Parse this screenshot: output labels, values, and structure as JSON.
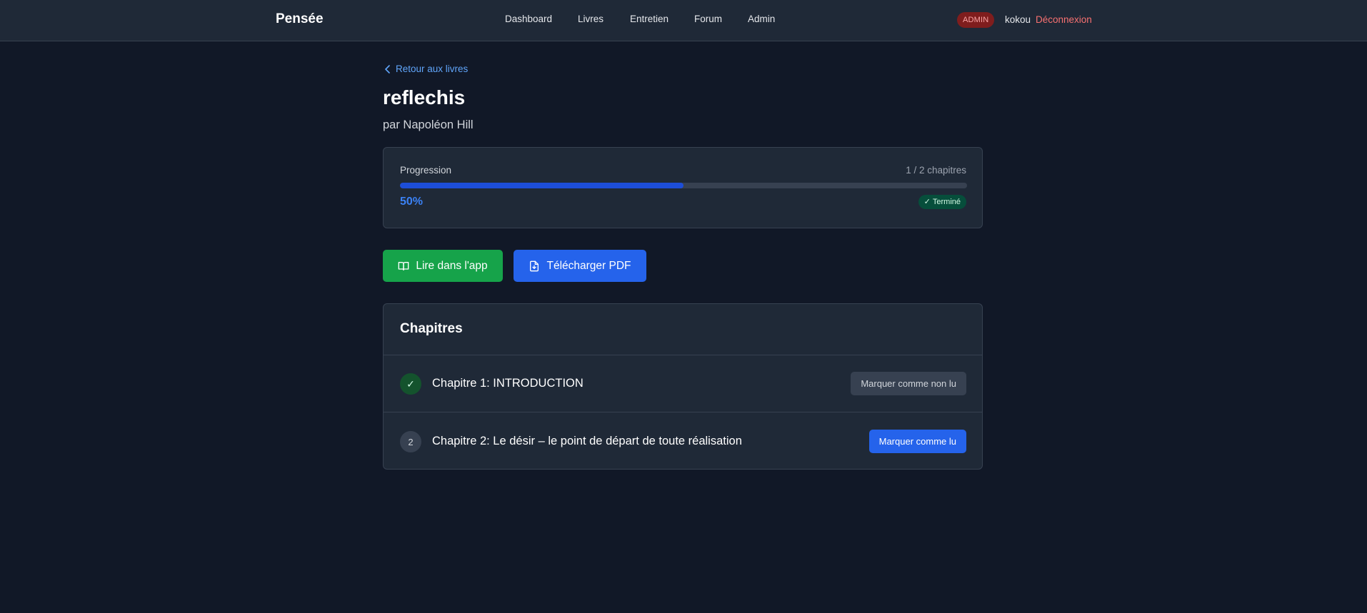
{
  "header": {
    "brand": "Pensée",
    "nav": [
      {
        "label": "Dashboard"
      },
      {
        "label": "Livres"
      },
      {
        "label": "Entretien"
      },
      {
        "label": "Forum"
      },
      {
        "label": "Admin"
      }
    ],
    "role_badge": "ADMIN",
    "username": "kokou",
    "logout_label": "Déconnexion"
  },
  "colors": {
    "page_bg": "#111827",
    "card_bg": "#1f2937",
    "accent_blue": "#2563eb",
    "accent_green": "#16a34a",
    "danger": "#f87171"
  },
  "book": {
    "back_label": "Retour aux livres",
    "title": "reflechis",
    "author": "par Napoléon Hill"
  },
  "progress": {
    "label": "Progression",
    "count": "1 / 2 chapitres",
    "percent_text": "50%",
    "percent_value": 50,
    "status_badge": "Terminé",
    "status_icon": "check-icon"
  },
  "actions": {
    "read_label": "Lire dans l'app",
    "read_icon": "book-open-icon",
    "pdf_label": "Télécharger PDF",
    "pdf_icon": "file-download-icon"
  },
  "chapters": {
    "title": "Chapitres",
    "items": [
      {
        "marker": "✓",
        "title": "Chapitre 1: INTRODUCTION",
        "read": true,
        "action": "Marquer comme non lu"
      },
      {
        "marker": "2",
        "title": "Chapitre 2: Le désir – le point de départ de toute réalisation",
        "read": false,
        "action": "Marquer comme lu"
      }
    ]
  }
}
